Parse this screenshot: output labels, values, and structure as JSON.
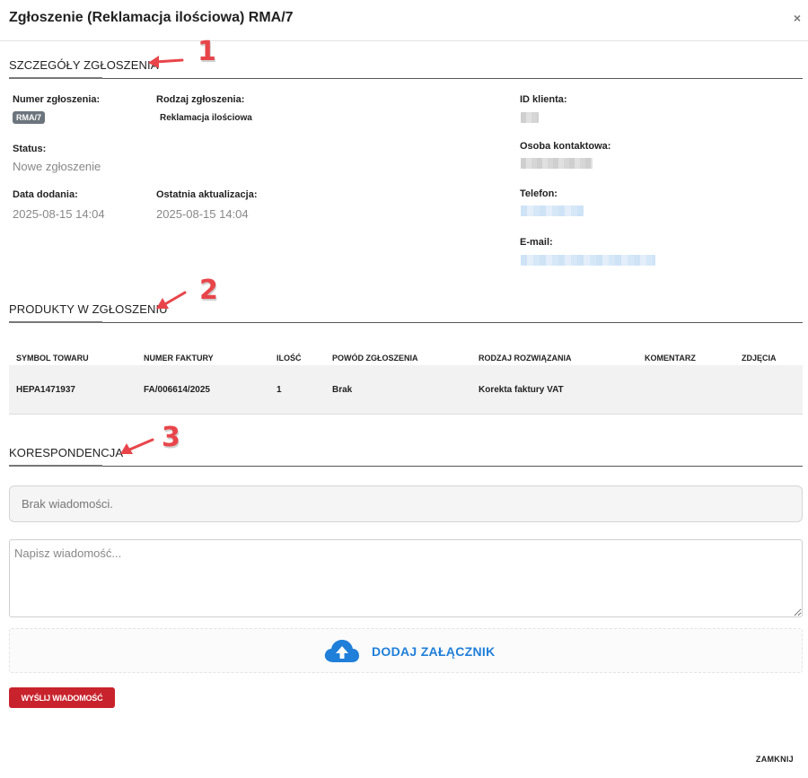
{
  "modal": {
    "title": "Zgłoszenie (Reklamacja ilościowa) RMA/7",
    "close_symbol": "×",
    "close_footer_label": "ZAMKNIJ"
  },
  "annotations": [
    "1",
    "2",
    "3"
  ],
  "details": {
    "heading": "SZCZEGÓŁY ZGŁOSZENIA",
    "number_label": "Numer zgłoszenia:",
    "number_value": "RMA/7",
    "type_label": "Rodzaj zgłoszenia:",
    "type_value": "Reklamacja ilościowa",
    "status_label": "Status:",
    "status_value": "Nowe zgłoszenie",
    "added_label": "Data dodania:",
    "added_value": "2025-08-15 14:04",
    "updated_label": "Ostatnia aktualizacja:",
    "updated_value": "2025-08-15 14:04",
    "client_id_label": "ID klienta:",
    "contact_label": "Osoba kontaktowa:",
    "phone_label": "Telefon:",
    "email_label": "E-mail:"
  },
  "products": {
    "heading": "PRODUKTY W ZGŁOSZENIU",
    "columns": [
      "SYMBOL TOWARU",
      "NUMER FAKTURY",
      "ILOŚĆ",
      "POWÓD ZGŁOSZENIA",
      "RODZAJ ROZWIĄZANIA",
      "KOMENTARZ",
      "ZDJĘCIA"
    ],
    "rows": [
      [
        "HEPA1471937",
        "FA/006614/2025",
        "1",
        "Brak",
        "Korekta faktury VAT",
        "",
        ""
      ]
    ]
  },
  "correspondence": {
    "heading": "KORESPONDENCJA",
    "empty_text": "Brak wiadomości.",
    "message_placeholder": "Napisz wiadomość...",
    "attach_label": "DODAJ ZAŁĄCZNIK",
    "send_label": "WYŚLIJ WIADOMOŚĆ"
  },
  "colors": {
    "annotation": "#e8454a",
    "accent_blue": "#1f7fd9",
    "send_red": "#c8232c",
    "badge_grey": "#6c757d"
  },
  "icons": {
    "close": "close-icon",
    "arrow": "arrow-left-icon",
    "upload": "cloud-upload-icon"
  }
}
